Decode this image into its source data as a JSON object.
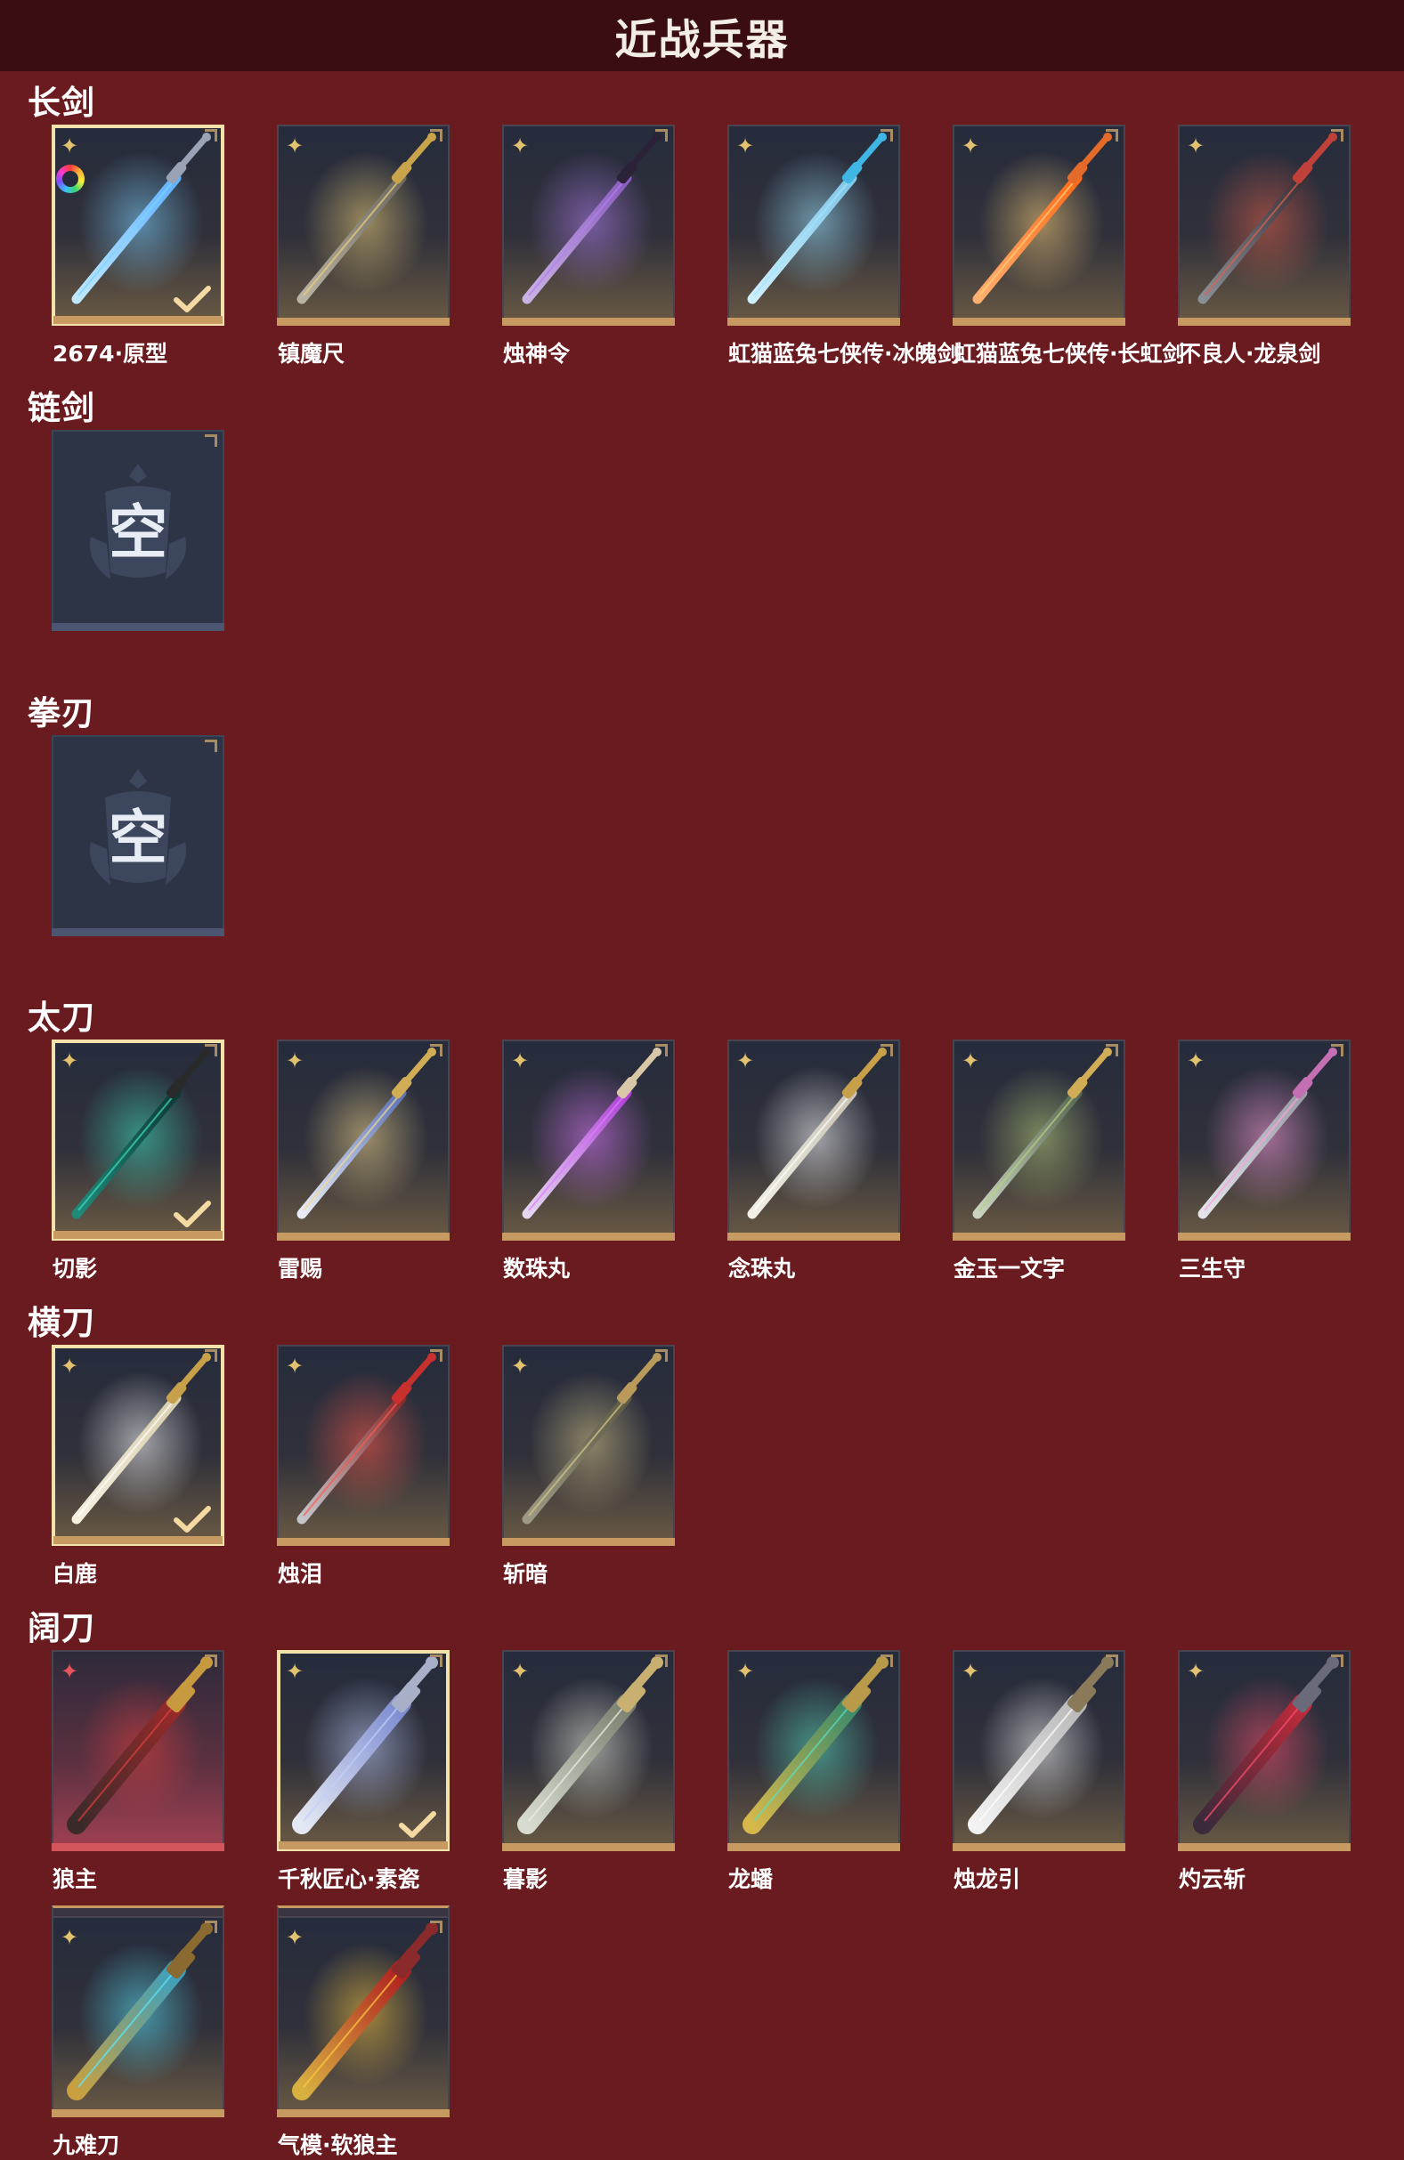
{
  "title": "近战兵器",
  "empty_text": "空",
  "colors": {
    "background": "#6a1b1f",
    "header": "#3a0d10",
    "gold_accent": "#c79a62",
    "red_accent": "#d3565c",
    "selected_border": "#f3e2a9"
  },
  "sections": [
    {
      "key": "changjian",
      "title": "长剑",
      "items": [
        {
          "name": "2674·原型",
          "selected": true,
          "rarity": "gold",
          "icon": "rainbow-ring-icon",
          "weapon": "light-blue-laser-sword"
        },
        {
          "name": "镇魔尺",
          "selected": false,
          "rarity": "gold",
          "weapon": "gold-hilt-straight-sword"
        },
        {
          "name": "烛神令",
          "selected": false,
          "rarity": "gold",
          "weapon": "purple-curved-sword"
        },
        {
          "name": "虹猫蓝兔七侠传·冰魄剑",
          "selected": false,
          "rarity": "gold",
          "weapon": "ice-blue-sword"
        },
        {
          "name": "虹猫蓝兔七侠传·长虹剑",
          "selected": false,
          "rarity": "gold",
          "weapon": "flame-orange-sword"
        },
        {
          "name": "不良人·龙泉剑",
          "selected": false,
          "rarity": "gold",
          "weapon": "dark-red-ornate-sword"
        }
      ]
    },
    {
      "key": "lianjian",
      "title": "链剑",
      "items": []
    },
    {
      "key": "quanren",
      "title": "拳刃",
      "items": []
    },
    {
      "key": "taidao",
      "title": "太刀",
      "items": [
        {
          "name": "切影",
          "selected": true,
          "rarity": "gold",
          "weapon": "teal-dark-katana"
        },
        {
          "name": "雷赐",
          "selected": false,
          "rarity": "gold",
          "weapon": "blue-gold-katana"
        },
        {
          "name": "数珠丸",
          "selected": false,
          "rarity": "gold",
          "weapon": "purple-bead-katana"
        },
        {
          "name": "念珠丸",
          "selected": false,
          "rarity": "gold",
          "weapon": "white-gold-katana"
        },
        {
          "name": "金玉一文字",
          "selected": false,
          "rarity": "gold",
          "weapon": "jade-gold-katana"
        },
        {
          "name": "三生守",
          "selected": false,
          "rarity": "gold",
          "weapon": "silver-pink-katana"
        }
      ]
    },
    {
      "key": "hengdao",
      "title": "横刀",
      "items": [
        {
          "name": "白鹿",
          "selected": true,
          "rarity": "gold",
          "weapon": "white-antler-blade"
        },
        {
          "name": "烛泪",
          "selected": false,
          "rarity": "gold",
          "weapon": "red-flame-blade"
        },
        {
          "name": "斩暗",
          "selected": false,
          "rarity": "gold",
          "weapon": "bronze-beast-blade"
        }
      ]
    },
    {
      "key": "kuodao",
      "title": "阔刀",
      "items": [
        {
          "name": "狼主",
          "selected": false,
          "rarity": "red",
          "weapon": "crimson-wolf-broadsword"
        },
        {
          "name": "千秋匠心·素瓷",
          "selected": true,
          "rarity": "gold",
          "weapon": "porcelain-blue-broadsword"
        },
        {
          "name": "暮影",
          "selected": false,
          "rarity": "gold",
          "weapon": "silver-jade-broadsword"
        },
        {
          "name": "龙蟠",
          "selected": false,
          "rarity": "gold",
          "weapon": "gold-jade-dragon-broadsword"
        },
        {
          "name": "烛龙引",
          "selected": false,
          "rarity": "gold",
          "weapon": "white-dragon-broadsword"
        },
        {
          "name": "灼云斩",
          "selected": false,
          "rarity": "gold",
          "weapon": "dark-flame-broadsword"
        },
        {
          "name": "九难刀",
          "selected": false,
          "rarity": "gold",
          "stacked": true,
          "weapon": "cyan-gold-broadsword"
        },
        {
          "name": "气模·软狼主",
          "selected": false,
          "rarity": "gold",
          "stacked": true,
          "weapon": "red-gold-broadsword"
        }
      ]
    }
  ]
}
